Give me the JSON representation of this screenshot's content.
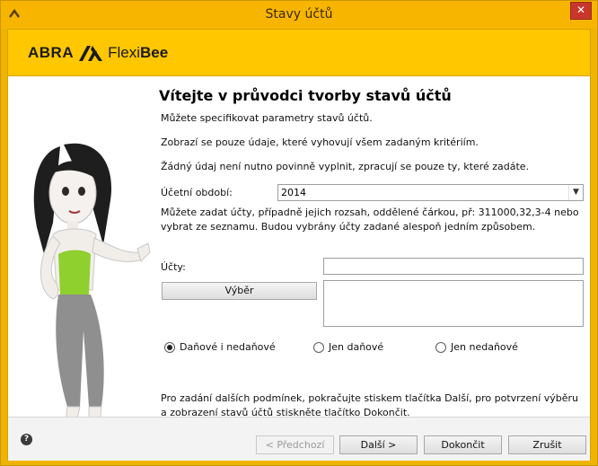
{
  "window": {
    "title": "Stavy účtů",
    "close_glyph": "✕",
    "app_icon": "chevron-up-icon"
  },
  "logo": {
    "abra": "ABRA",
    "flexi": "Flexi",
    "bee": "Bee"
  },
  "content": {
    "heading": "Vítejte v průvodci tvorby stavů účtů",
    "line1": "Můžete specifikovat parametry stavů účtů.",
    "line2": "Zobrazí se pouze údaje, které vyhovují všem zadaným kritériím.",
    "line3": "Žádný údaj není nutno povinně vyplnit, zpracují se pouze ty, které zadáte.",
    "period_label": "Účetní období:",
    "period_value": "2014",
    "accounts_hint": "Můžete zadat účty, případně jejich rozsah, oddělené čárkou, př: 311000,32,3-4 nebo vybrat ze seznamu. Budou vybrány účty zadané alespoň jedním způsobem.",
    "accounts_label": "Účty:",
    "accounts_value": "",
    "select_button": "Výběr",
    "radio_options": [
      {
        "label": "Daňové i nedaňové",
        "checked": true
      },
      {
        "label": "Jen daňové",
        "checked": false
      },
      {
        "label": "Jen nedaňové",
        "checked": false
      }
    ],
    "bottom_note": "Pro zadání dalších podmínek, pokračujte stiskem tlačítka Další, pro potvrzení výběru a zobrazení stavů účtů stiskněte tlačítko Dokončit."
  },
  "footer": {
    "help_glyph": "?",
    "prev": "< Předchozí",
    "next": "Další >",
    "finish": "Dokončit",
    "cancel": "Zrušit"
  },
  "colors": {
    "brand_yellow": "#ffc700",
    "titlebar": "#f7b500",
    "close_red": "#c7372b"
  }
}
